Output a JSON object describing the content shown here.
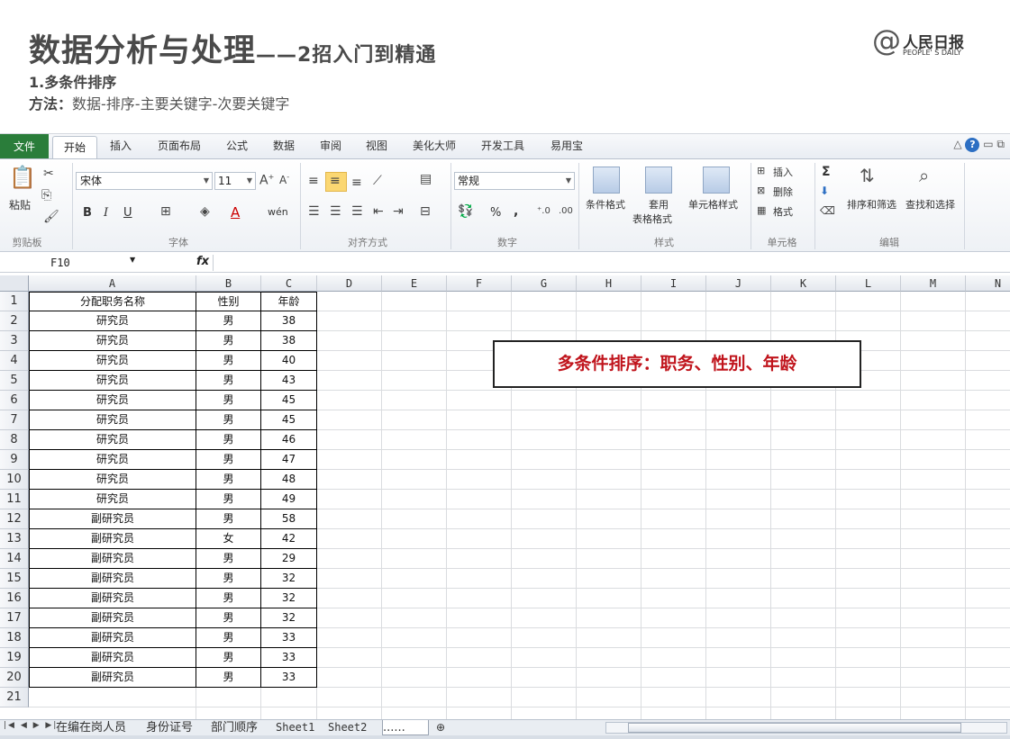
{
  "slide": {
    "title": "数据分析与处理",
    "title_suffix": "——2招入门到精通",
    "subheading": "1.多条件排序",
    "method_label": "方法：",
    "method_text": "数据-排序-主要关键字-次要关键字",
    "logo_at": "@",
    "logo_cn": "人民日报",
    "logo_en": "PEOPLE' S DAILY"
  },
  "ribbon": {
    "tabs": [
      "文件",
      "开始",
      "插入",
      "页面布局",
      "公式",
      "数据",
      "审阅",
      "视图",
      "美化大师",
      "开发工具",
      "易用宝"
    ],
    "active_tab": "开始",
    "font_name": "宋体",
    "font_size": "11",
    "number_format": "常规",
    "groups": {
      "clipboard": "剪贴板",
      "font": "字体",
      "alignment": "对齐方式",
      "number": "数字",
      "styles": "样式",
      "cells": "单元格",
      "editing": "编辑"
    },
    "buttons": {
      "paste": "粘贴",
      "conditional_format": "条件格式",
      "table_format_1": "套用",
      "table_format_2": "表格格式",
      "cell_styles": "单元格样式",
      "insert": "插入",
      "delete": "删除",
      "format": "格式",
      "sort_filter": "排序和筛选",
      "find_select": "查找和选择",
      "bold": "B",
      "italic": "I",
      "underline": "U",
      "font_color": "A",
      "wen": "wén",
      "percent": "%",
      "comma": ",",
      "sigma": "Σ"
    }
  },
  "formula_bar": {
    "name_box": "F10",
    "fx": "fx",
    "formula": ""
  },
  "sheet": {
    "columns": [
      "A",
      "B",
      "C",
      "D",
      "E",
      "F",
      "G",
      "H",
      "I",
      "J",
      "K",
      "L",
      "M",
      "N"
    ],
    "row_numbers": [
      "1",
      "2",
      "3",
      "4",
      "5",
      "6",
      "7",
      "8",
      "9",
      "10",
      "11",
      "12",
      "13",
      "14",
      "15",
      "16",
      "17",
      "18",
      "19",
      "20",
      "21"
    ],
    "header": [
      "分配职务名称",
      "性别",
      "年龄"
    ],
    "rows": [
      [
        "研究员",
        "男",
        "38"
      ],
      [
        "研究员",
        "男",
        "38"
      ],
      [
        "研究员",
        "男",
        "40"
      ],
      [
        "研究员",
        "男",
        "43"
      ],
      [
        "研究员",
        "男",
        "45"
      ],
      [
        "研究员",
        "男",
        "45"
      ],
      [
        "研究员",
        "男",
        "46"
      ],
      [
        "研究员",
        "男",
        "47"
      ],
      [
        "研究员",
        "男",
        "48"
      ],
      [
        "研究员",
        "男",
        "49"
      ],
      [
        "副研究员",
        "男",
        "58"
      ],
      [
        "副研究员",
        "女",
        "42"
      ],
      [
        "副研究员",
        "男",
        "29"
      ],
      [
        "副研究员",
        "男",
        "32"
      ],
      [
        "副研究员",
        "男",
        "32"
      ],
      [
        "副研究员",
        "男",
        "32"
      ],
      [
        "副研究员",
        "男",
        "33"
      ],
      [
        "副研究员",
        "男",
        "33"
      ],
      [
        "副研究员",
        "男",
        "33"
      ]
    ],
    "callout": "多条件排序：职务、性别、年龄"
  },
  "sheet_tabs": {
    "tabs": [
      "在编在岗人员",
      "身份证号",
      "部门顺序",
      "Sheet1",
      "Sheet2"
    ],
    "active_tab": "......"
  },
  "colors": {
    "file_tab": "#2a7d3a",
    "callout_text": "#c0141c",
    "highlight": "#fbd772"
  }
}
